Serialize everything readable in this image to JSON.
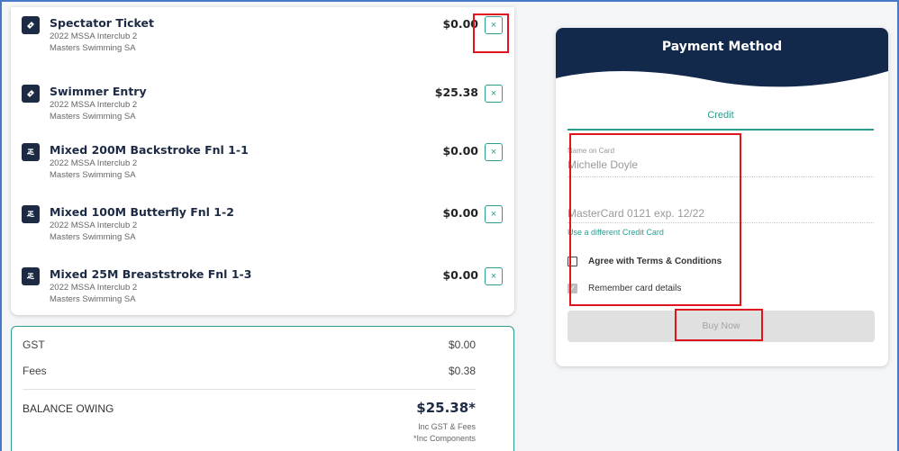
{
  "cart": {
    "items": [
      {
        "title": "Spectator Ticket",
        "event": "2022 MSSA Interclub 2",
        "org": "Masters Swimming SA",
        "price": "$0.00",
        "icon": "ticket-icon"
      },
      {
        "title": "Swimmer Entry",
        "event": "2022 MSSA Interclub 2",
        "org": "Masters Swimming SA",
        "price": "$25.38",
        "icon": "ticket-icon"
      },
      {
        "title": "Mixed 200M Backstroke Fnl 1-1",
        "event": "2022 MSSA Interclub 2",
        "org": "Masters Swimming SA",
        "price": "$0.00",
        "icon": "swimmer-icon"
      },
      {
        "title": "Mixed 100M Butterfly Fnl 1-2",
        "event": "2022 MSSA Interclub 2",
        "org": "Masters Swimming SA",
        "price": "$0.00",
        "icon": "swimmer-icon"
      },
      {
        "title": "Mixed 25M Breaststroke Fnl 1-3",
        "event": "2022 MSSA Interclub 2",
        "org": "Masters Swimming SA",
        "price": "$0.00",
        "icon": "swimmer-icon"
      }
    ],
    "remove_glyph": "×"
  },
  "totals": {
    "gst_label": "GST",
    "gst_value": "$0.00",
    "fees_label": "Fees",
    "fees_value": "$0.38",
    "balance_label": "BALANCE OWING",
    "balance_value": "$25.38*",
    "note1": "Inc GST & Fees",
    "note2": "*Inc Components"
  },
  "payment": {
    "title": "Payment Method",
    "tab_credit": "Credit",
    "name_label": "Name on Card",
    "name_value": "Michelle Doyle",
    "card_value": "MasterCard 0121 exp. 12/22",
    "different_card": "Use a different Credit Card",
    "terms_label": "Agree with Terms & Conditions",
    "remember_label": "Remember card details",
    "remember_checked": true,
    "terms_checked": false,
    "buy_label": "Buy Now"
  },
  "colors": {
    "navy": "#1c2a44",
    "teal": "#2a9d8f",
    "highlight": "#e0141e"
  }
}
